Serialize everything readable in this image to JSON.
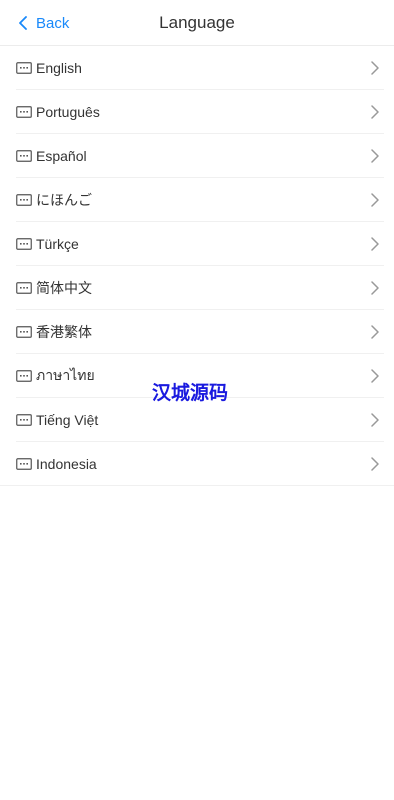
{
  "header": {
    "back_label": "Back",
    "title": "Language"
  },
  "languages": [
    {
      "label": "English",
      "icon": "keyboard-icon"
    },
    {
      "label": "Português",
      "icon": "keyboard-icon"
    },
    {
      "label": "Español",
      "icon": "keyboard-icon"
    },
    {
      "label": "にほんご",
      "icon": "keyboard-icon"
    },
    {
      "label": "Türkçe",
      "icon": "keyboard-icon"
    },
    {
      "label": "简体中文",
      "icon": "keyboard-icon"
    },
    {
      "label": "香港繁体",
      "icon": "keyboard-icon"
    },
    {
      "label": "ภาษาไทย",
      "icon": "keyboard-icon"
    },
    {
      "label": "Tiếng Việt",
      "icon": "keyboard-icon"
    },
    {
      "label": "Indonesia",
      "icon": "keyboard-icon"
    }
  ],
  "watermark": "汉城源码",
  "colors": {
    "accent": "#1989fa",
    "text": "#333333",
    "icon": "#555555",
    "chevron": "#999999",
    "divider": "#f0f0f0",
    "watermark": "#1a1adf"
  }
}
